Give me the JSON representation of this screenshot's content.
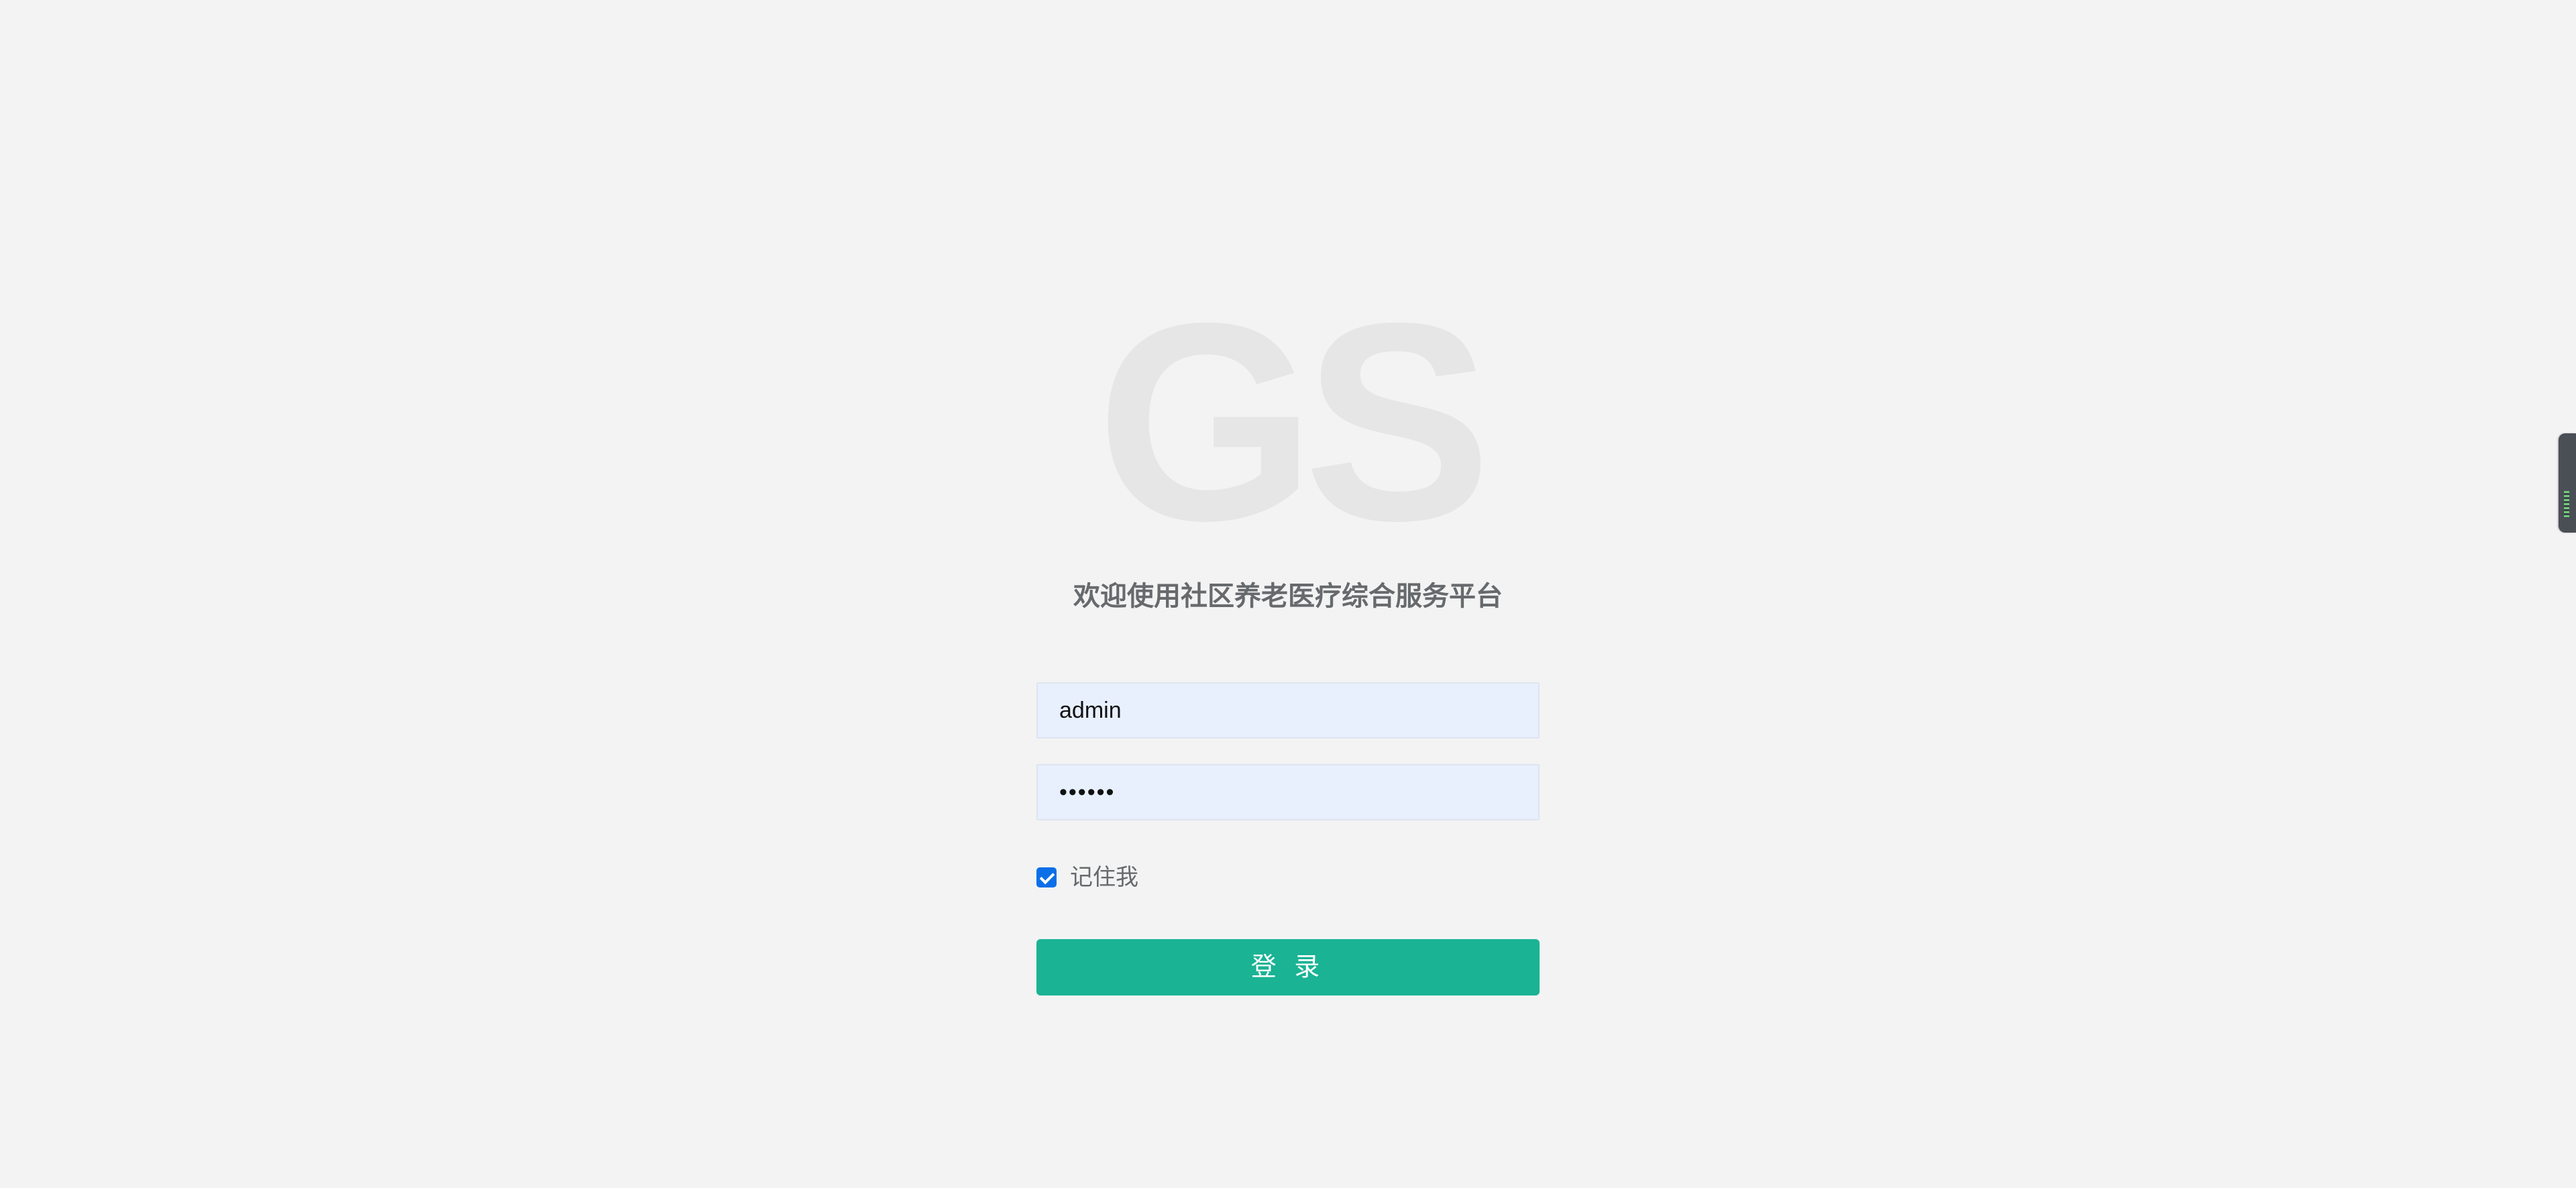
{
  "logo": {
    "text": "GS"
  },
  "welcome": {
    "title": "欢迎使用社区养老医疗综合服务平台"
  },
  "form": {
    "username_value": "admin",
    "password_display": "••••••",
    "remember_label": "记住我",
    "remember_checked": true,
    "login_label": "登 录"
  },
  "colors": {
    "background": "#f3f3f4",
    "button": "#1ab394",
    "input_background": "#e8f0fe",
    "checkbox": "#0b6fe8"
  },
  "side_widget": {
    "icon": "side-panel-icon"
  }
}
